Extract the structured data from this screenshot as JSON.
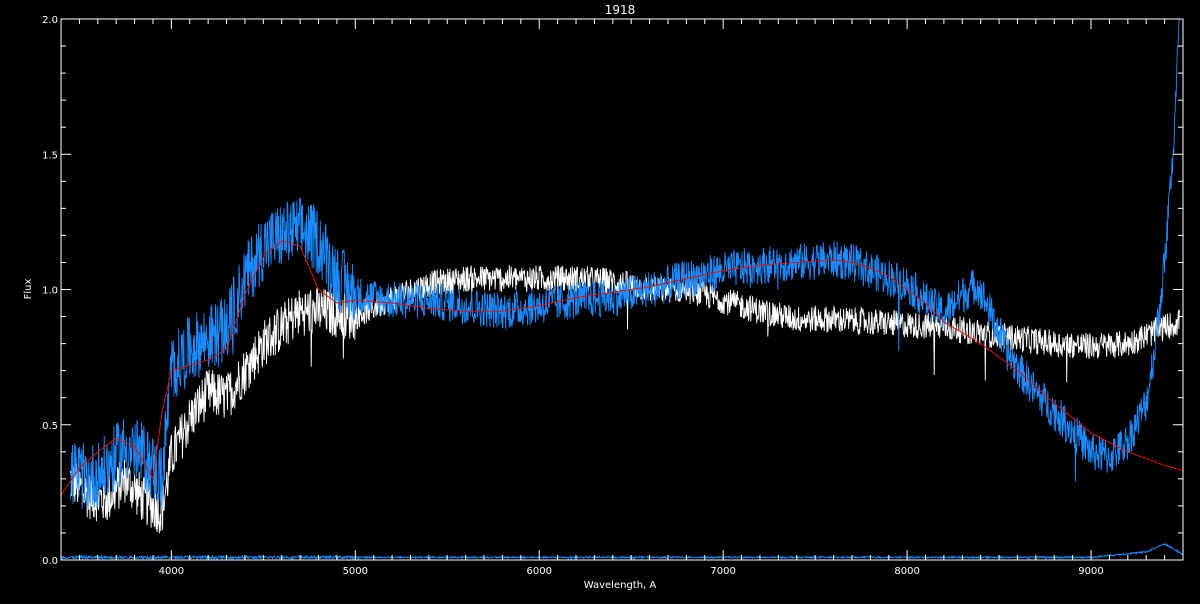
{
  "chart_data": {
    "type": "line",
    "title": "1918",
    "xlabel": "Wavelength, A",
    "ylabel": "Flux",
    "xlim": [
      3400,
      9500
    ],
    "ylim": [
      0.0,
      2.0
    ],
    "x_ticks": [
      4000,
      5000,
      6000,
      7000,
      8000,
      9000
    ],
    "x_tick_labels": [
      "4000",
      "5000",
      "6000",
      "7000",
      "8000",
      "9000"
    ],
    "y_ticks": [
      0.0,
      0.5,
      1.0,
      1.5,
      2.0
    ],
    "y_tick_labels": [
      "0.0",
      "0.5",
      "1.0",
      "1.5",
      "2.0"
    ],
    "grid": false,
    "background": "#000000",
    "series": [
      {
        "color": "#ffffff",
        "noise": 0.05,
        "x": [
          3450,
          3550,
          3650,
          3750,
          3850,
          3950,
          4000,
          4100,
          4200,
          4300,
          4400,
          4500,
          4600,
          4700,
          4800,
          4900,
          5000,
          5200,
          5400,
          5600,
          5800,
          6000,
          6200,
          6400,
          6600,
          6800,
          7000,
          7200,
          7400,
          7600,
          7800,
          8000,
          8200,
          8400,
          8600,
          8800,
          9000,
          9200,
          9300,
          9400,
          9480
        ],
        "y": [
          0.3,
          0.24,
          0.22,
          0.3,
          0.22,
          0.18,
          0.38,
          0.52,
          0.62,
          0.6,
          0.7,
          0.8,
          0.86,
          0.92,
          0.92,
          0.91,
          0.9,
          0.97,
          1.02,
          1.04,
          1.04,
          1.04,
          1.04,
          1.03,
          1.0,
          1.0,
          0.96,
          0.92,
          0.89,
          0.89,
          0.88,
          0.87,
          0.86,
          0.84,
          0.82,
          0.8,
          0.79,
          0.8,
          0.83,
          0.86,
          0.88
        ]
      },
      {
        "color": "#1a8cff",
        "noise": 0.07,
        "x": [
          3450,
          3550,
          3650,
          3750,
          3850,
          3950,
          4000,
          4100,
          4200,
          4300,
          4400,
          4500,
          4600,
          4700,
          4800,
          4900,
          5000,
          5200,
          5400,
          5600,
          5800,
          6000,
          6200,
          6400,
          6600,
          6800,
          7000,
          7200,
          7400,
          7600,
          7700,
          7800,
          8000,
          8100,
          8200,
          8300,
          8380,
          8450,
          8550,
          8700,
          8900,
          9000,
          9100,
          9200,
          9300,
          9350,
          9400,
          9450,
          9480
        ],
        "y": [
          0.32,
          0.3,
          0.34,
          0.42,
          0.38,
          0.3,
          0.7,
          0.78,
          0.82,
          0.85,
          1.04,
          1.16,
          1.2,
          1.22,
          1.18,
          1.05,
          0.98,
          0.96,
          0.96,
          0.94,
          0.92,
          0.94,
          0.96,
          0.97,
          1.0,
          1.04,
          1.07,
          1.09,
          1.1,
          1.11,
          1.1,
          1.07,
          1.02,
          0.96,
          0.91,
          0.98,
          1.02,
          0.92,
          0.76,
          0.62,
          0.48,
          0.4,
          0.38,
          0.44,
          0.58,
          0.8,
          1.1,
          1.55,
          2.0
        ]
      },
      {
        "color": "#e01010",
        "noise": 0.0,
        "x": [
          3400,
          3500,
          3600,
          3700,
          3800,
          3900,
          3950,
          4000,
          4100,
          4200,
          4300,
          4400,
          4500,
          4600,
          4700,
          4800,
          4900,
          5000,
          5200,
          5400,
          5600,
          5800,
          6000,
          6200,
          6400,
          6600,
          6800,
          7000,
          7200,
          7400,
          7600,
          7700,
          7800,
          7900,
          8000,
          8100,
          8200,
          8400,
          8600,
          8800,
          9000,
          9200,
          9400,
          9500
        ],
        "y": [
          0.24,
          0.34,
          0.4,
          0.45,
          0.42,
          0.3,
          0.55,
          0.7,
          0.72,
          0.74,
          0.78,
          0.98,
          1.12,
          1.18,
          1.16,
          1.0,
          0.95,
          0.96,
          0.95,
          0.93,
          0.92,
          0.92,
          0.94,
          0.97,
          0.99,
          1.01,
          1.04,
          1.07,
          1.09,
          1.1,
          1.11,
          1.1,
          1.08,
          1.05,
          1.0,
          0.95,
          0.88,
          0.8,
          0.7,
          0.58,
          0.47,
          0.4,
          0.35,
          0.33
        ]
      },
      {
        "color": "#1a8cff",
        "noise": 0.003,
        "x": [
          3400,
          6000,
          9000,
          9300,
          9400,
          9500
        ],
        "y": [
          0.01,
          0.01,
          0.01,
          0.03,
          0.06,
          0.02
        ]
      }
    ]
  }
}
